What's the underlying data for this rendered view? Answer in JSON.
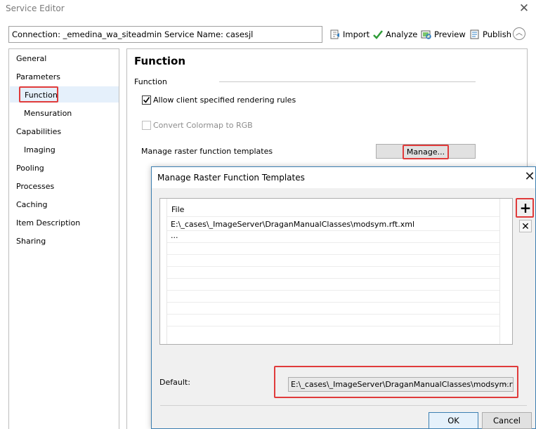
{
  "window": {
    "title": "Service Editor"
  },
  "toolbar": {
    "connection_text": "Connection: _emedina_wa_siteadmin   Service Name: casesjl",
    "import_label": "Import",
    "analyze_label": "Analyze",
    "preview_label": "Preview",
    "publish_label": "Publish"
  },
  "sidebar": {
    "items": [
      {
        "label": "General"
      },
      {
        "label": "Parameters"
      },
      {
        "label": "Function"
      },
      {
        "label": "Mensuration"
      },
      {
        "label": "Capabilities"
      },
      {
        "label": "Imaging"
      },
      {
        "label": "Pooling"
      },
      {
        "label": "Processes"
      },
      {
        "label": "Caching"
      },
      {
        "label": "Item Description"
      },
      {
        "label": "Sharing"
      }
    ],
    "selected": "Function"
  },
  "main": {
    "title": "Function",
    "section_label": "Function",
    "allow_client_rules": {
      "label": "Allow client specified rendering rules",
      "checked": true
    },
    "convert_colormap": {
      "label": "Convert Colormap to RGB",
      "checked": false,
      "enabled": false
    },
    "manage_templates_label": "Manage raster function templates",
    "manage_button": "Manage..."
  },
  "dialog": {
    "title": "Manage Raster Function Templates",
    "list": {
      "header": "File",
      "rows": [
        "E:\\_cases\\_ImageServer\\DraganManualClasses\\modsym.rft.xml",
        "..."
      ]
    },
    "add_button": "+",
    "remove_button": "✕",
    "default_label": "Default:",
    "default_value": "E:\\_cases\\_ImageServer\\DraganManualClasses\\modsym.rft.x",
    "ok_button": "OK",
    "cancel_button": "Cancel"
  },
  "colors": {
    "highlight": "#e03b3b",
    "selection": "#e5f0fb",
    "dialog_border": "#3c7fb1"
  }
}
